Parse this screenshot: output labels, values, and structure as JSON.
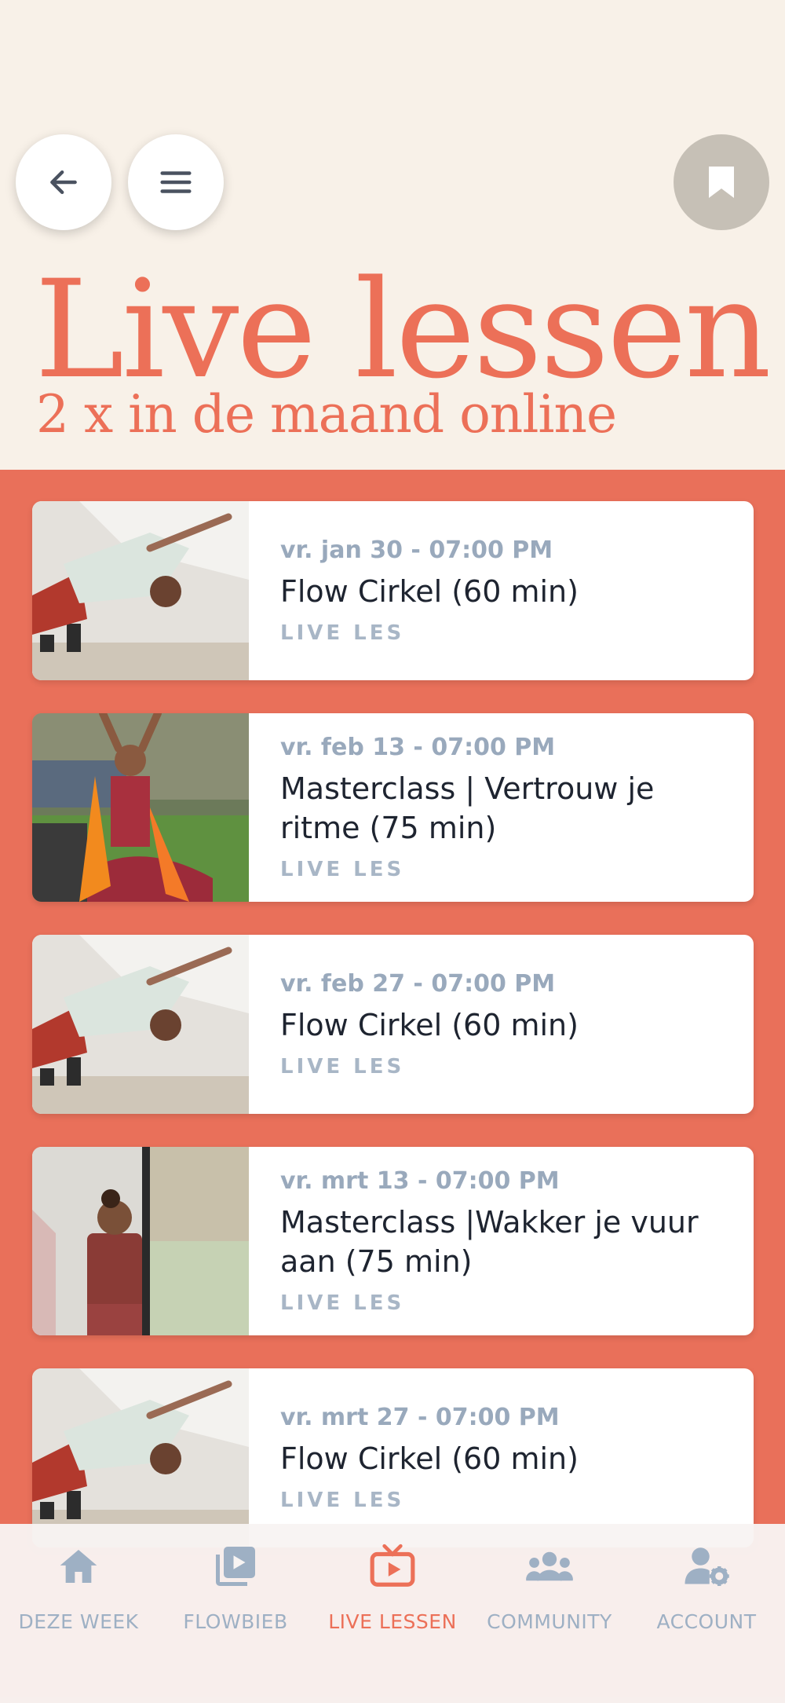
{
  "header": {
    "back_icon": "arrow-left-icon",
    "menu_icon": "hamburger-menu-icon",
    "bookmark_icon": "bookmark-icon"
  },
  "hero": {
    "title": "Live lessen",
    "subtitle": "2 x in de maand online"
  },
  "colors": {
    "accent": "#ec7058",
    "list_background": "#e9705a",
    "hero_background": "#f8f1e8",
    "muted_text": "#99a9bc",
    "title_text": "#1e2430"
  },
  "lessons": [
    {
      "date": "vr. jan 30 - 07:00 PM",
      "title": "Flow Cirkel (60 min)",
      "tag": "LIVE LES"
    },
    {
      "date": "vr. feb 13 - 07:00 PM",
      "title": "Masterclass | Vertrouw je ritme (75 min)",
      "tag": "LIVE LES"
    },
    {
      "date": "vr. feb 27 - 07:00 PM",
      "title": "Flow Cirkel (60 min)",
      "tag": "LIVE LES"
    },
    {
      "date": "vr. mrt 13 - 07:00 PM",
      "title": "Masterclass |Wakker je vuur aan (75 min)",
      "tag": "LIVE LES"
    },
    {
      "date": "vr. mrt 27 - 07:00 PM",
      "title": "Flow Cirkel (60 min)",
      "tag": "LIVE LES"
    }
  ],
  "tabbar": {
    "tabs": [
      {
        "label": "DEZE WEEK",
        "icon": "home-icon"
      },
      {
        "label": "FLOWBIEB",
        "icon": "video-library-icon"
      },
      {
        "label": "LIVE LESSEN",
        "icon": "live-tv-icon",
        "active": true
      },
      {
        "label": "COMMUNITY",
        "icon": "group-icon"
      },
      {
        "label": "ACCOUNT",
        "icon": "user-gear-icon"
      }
    ]
  }
}
